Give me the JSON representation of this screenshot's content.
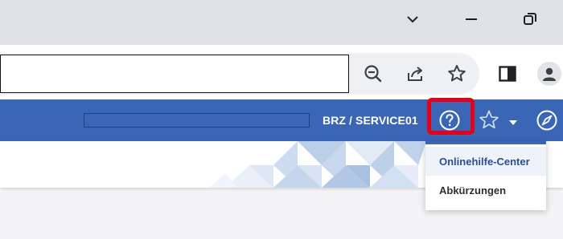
{
  "window_controls": {
    "icons": [
      "chevron-down-icon",
      "minimize-icon",
      "restore-icon"
    ]
  },
  "toolbar": {
    "address_value": "",
    "icons": [
      "zoom-out-icon",
      "share-icon",
      "bookmark-star-icon",
      "side-panel-icon",
      "profile-icon"
    ]
  },
  "app_header": {
    "user_label": "BRZ / SERVICE01",
    "colors": {
      "header_blue": "#3b66b6",
      "highlight_red": "#e3001b"
    },
    "icons": [
      "help-icon",
      "favorite-star-icon",
      "caret-down-icon",
      "compass-icon"
    ]
  },
  "help_menu": {
    "items": [
      {
        "label": "Onlinehilfe-Center",
        "active": true
      },
      {
        "label": "Abkürzungen",
        "active": false
      }
    ]
  }
}
